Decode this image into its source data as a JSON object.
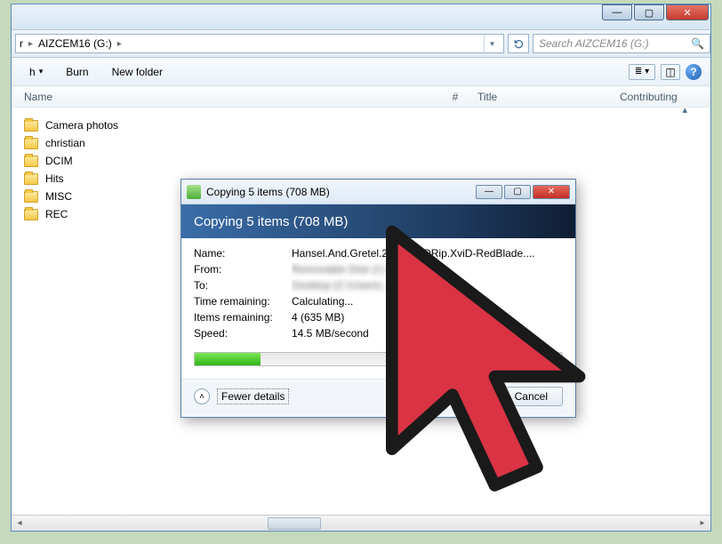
{
  "window": {
    "address": {
      "drive": "AIZCEM16 (G:)",
      "prefix": "r"
    },
    "search_placeholder": "Search AIZCEM16 (G:)"
  },
  "toolbar": {
    "back_suffix": "h",
    "burn": "Burn",
    "new_folder": "New folder"
  },
  "columns": {
    "name": "Name",
    "num": "#",
    "title": "Title",
    "contributing": "Contributing"
  },
  "files": [
    {
      "name": "Camera photos"
    },
    {
      "name": "christian"
    },
    {
      "name": "DCIM"
    },
    {
      "name": "Hits"
    },
    {
      "name": "MISC"
    },
    {
      "name": "REC"
    }
  ],
  "dialog": {
    "titlebar": "Copying 5 items (708 MB)",
    "header": "Copying 5 items (708 MB)",
    "rows": {
      "name_label": "Name:",
      "name_value": "Hansel.And.Gretel.2013.DVDRip.XviD-RedBlade....",
      "from_label": "From:",
      "from_value": "Removable Disk (I:)",
      "to_label": "To:",
      "to_value": "Desktop (C:\\Users\\...)",
      "time_label": "Time remaining:",
      "time_value": "Calculating...",
      "items_label": "Items remaining:",
      "items_value": "4 (635 MB)",
      "speed_label": "Speed:",
      "speed_value": "14.5 MB/second"
    },
    "progress_percent": 18,
    "fewer_details": "Fewer details",
    "cancel": "Cancel"
  }
}
